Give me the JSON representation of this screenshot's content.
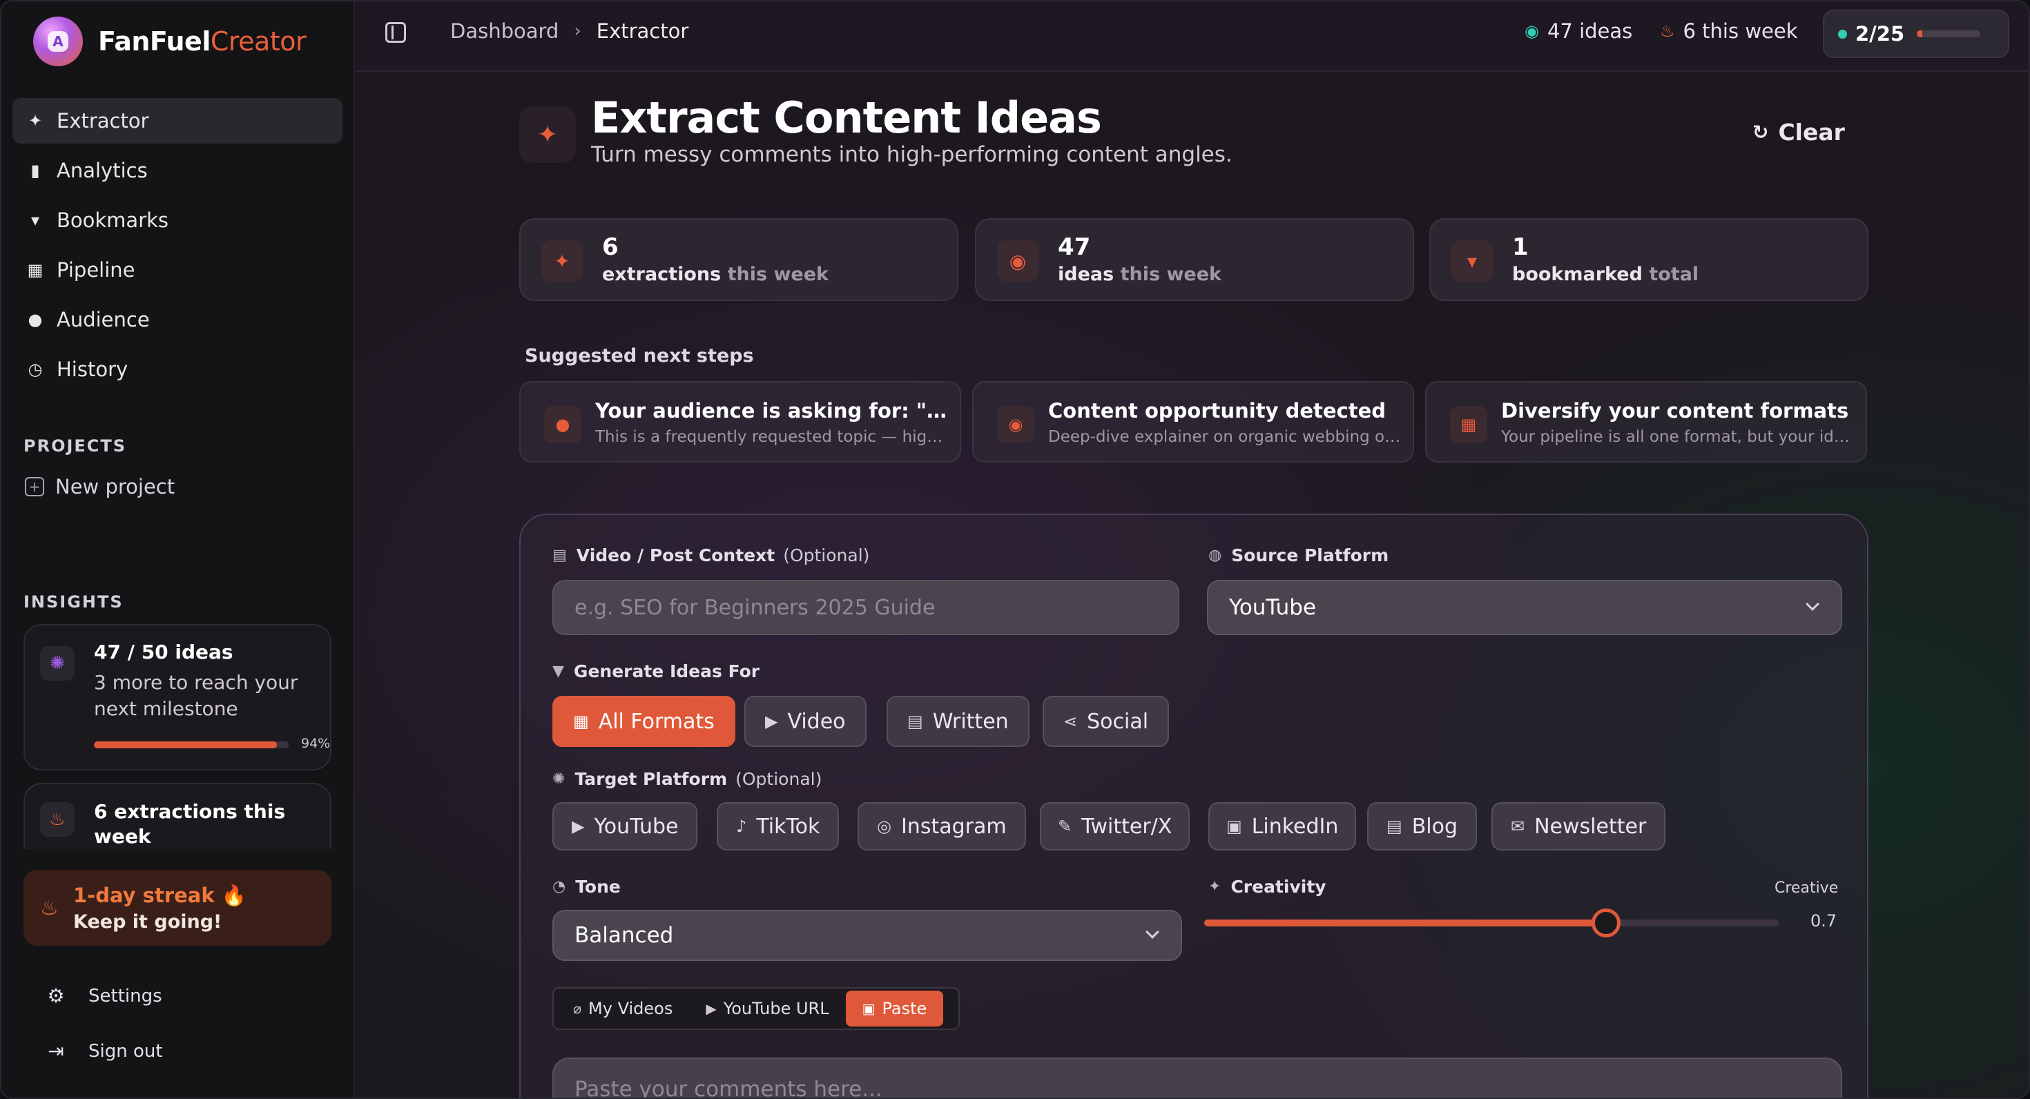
{
  "brand": {
    "name": "FanFuel",
    "accent": "Creator"
  },
  "sidebar": {
    "nav": [
      {
        "label": "Extractor",
        "icon": "wand-icon",
        "active": true
      },
      {
        "label": "Analytics",
        "icon": "bar-chart-icon"
      },
      {
        "label": "Bookmarks",
        "icon": "bookmark-icon"
      },
      {
        "label": "Pipeline",
        "icon": "pipeline-icon"
      },
      {
        "label": "Audience",
        "icon": "users-icon"
      },
      {
        "label": "History",
        "icon": "history-icon"
      }
    ],
    "projects_label": "PROJECTS",
    "new_project": "New project",
    "insights_label": "INSIGHTS",
    "insight_ideas": {
      "title": "47 / 50 ideas",
      "subtitle": "3 more to reach your next milestone",
      "progress_percent": 94,
      "progress_label": "94%"
    },
    "insight_extractions": {
      "title": "6 extractions this week"
    },
    "streak": {
      "title": "1-day streak 🔥",
      "subtitle": "Keep it going!"
    },
    "settings": "Settings",
    "sign_out": "Sign out"
  },
  "topbar": {
    "breadcrumb": {
      "root": "Dashboard",
      "current": "Extractor"
    },
    "ideas_stat": "47 ideas",
    "week_stat": "6 this week",
    "usage": {
      "label": "2/25",
      "fraction": 0.08
    }
  },
  "hero": {
    "title": "Extract Content Ideas",
    "subtitle": "Turn messy comments into high-performing content angles.",
    "clear": "Clear"
  },
  "stats": [
    {
      "num": "6",
      "label": "extractions",
      "muted": "this week"
    },
    {
      "num": "47",
      "label": "ideas",
      "muted": "this week"
    },
    {
      "num": "1",
      "label": "bookmarked",
      "muted": "total"
    }
  ],
  "suggestions": {
    "label": "Suggested next steps",
    "items": [
      {
        "title": "Your audience is asking for: \"Deta...",
        "subtitle": "This is a frequently requested topic — high ..."
      },
      {
        "title": "Content opportunity detected",
        "subtitle": "Deep-dive explainer on organic webbing ori..."
      },
      {
        "title": "Diversify your content formats",
        "subtitle": "Your pipeline is all one format, but your idea..."
      }
    ]
  },
  "form": {
    "context_label": "Video / Post Context",
    "context_optional": "(Optional)",
    "context_placeholder": "e.g. SEO for Beginners 2025 Guide",
    "source_label": "Source Platform",
    "source_value": "YouTube",
    "generate_label": "Generate Ideas For",
    "formats": [
      "All Formats",
      "Video",
      "Written",
      "Social"
    ],
    "target_label": "Target Platform",
    "target_optional": "(Optional)",
    "platforms": [
      "YouTube",
      "TikTok",
      "Instagram",
      "Twitter/X",
      "LinkedIn",
      "Blog",
      "Newsletter"
    ],
    "tone_label": "Tone",
    "tone_value": "Balanced",
    "creativity_label": "Creativity",
    "creativity_level": "Creative",
    "creativity_value": "0.7",
    "creativity": 0.7,
    "input_modes": [
      "My Videos",
      "YouTube URL",
      "Paste"
    ],
    "paste_placeholder": "Paste your comments here..."
  },
  "colors": {
    "accent": "#e0583a",
    "teal": "#2fd0b7"
  }
}
